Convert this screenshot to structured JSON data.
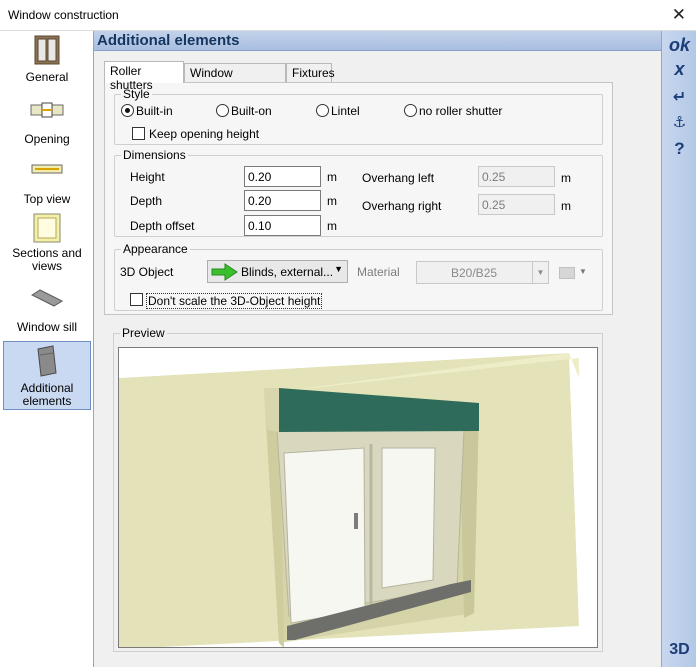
{
  "window": {
    "title": "Window construction",
    "close_glyph": "✕"
  },
  "sidebar": {
    "items": [
      {
        "label": "General",
        "icon": "window-general-icon"
      },
      {
        "label": "Opening",
        "icon": "opening-icon"
      },
      {
        "label": "Top view",
        "icon": "top-view-icon"
      },
      {
        "label": "Sections and views",
        "icon": "sections-icon"
      },
      {
        "label": "Window sill",
        "icon": "window-sill-icon"
      },
      {
        "label": "Additional elements",
        "icon": "additional-elements-icon",
        "active": true
      }
    ]
  },
  "header": {
    "title": "Additional elements"
  },
  "right_toolbar": {
    "ok": "ok",
    "cancel": "x",
    "enter": "↵",
    "anchor": "⚓",
    "help": "?",
    "view3d": "3D"
  },
  "tabs": [
    {
      "label": "Roller shutters",
      "active": true
    },
    {
      "label": "Window surrounds"
    },
    {
      "label": "Fixtures"
    }
  ],
  "style": {
    "legend": "Style",
    "options": [
      "Built-in",
      "Built-on",
      "Lintel",
      "no roller shutter"
    ],
    "selected": "Built-in",
    "keep_height_label": "Keep opening height",
    "keep_height_checked": false
  },
  "dimensions": {
    "legend": "Dimensions",
    "height_label": "Height",
    "height_value": "0.20",
    "height_unit": "m",
    "depth_label": "Depth",
    "depth_value": "0.20",
    "depth_unit": "m",
    "depth_offset_label": "Depth offset",
    "depth_offset_value": "0.10",
    "depth_offset_unit": "m",
    "overhang_left_label": "Overhang left",
    "overhang_left_value": "0.25",
    "overhang_left_unit": "m",
    "overhang_right_label": "Overhang right",
    "overhang_right_value": "0.25",
    "overhang_right_unit": "m"
  },
  "appearance": {
    "legend": "Appearance",
    "object_label": "3D Object",
    "object_button": "Blinds, external...",
    "material_label": "Material",
    "material_value": "B20/B25",
    "dont_scale_label": "Don't scale the 3D-Object height",
    "dont_scale_checked": false
  },
  "preview": {
    "legend": "Preview"
  },
  "colors": {
    "accent": "#15365f",
    "header_bar": "#b6c9e6",
    "wall": "#e0dfb4",
    "shutter": "#2e6b5a",
    "sill": "#6b6b68",
    "arrow": "#3bbf2f"
  }
}
